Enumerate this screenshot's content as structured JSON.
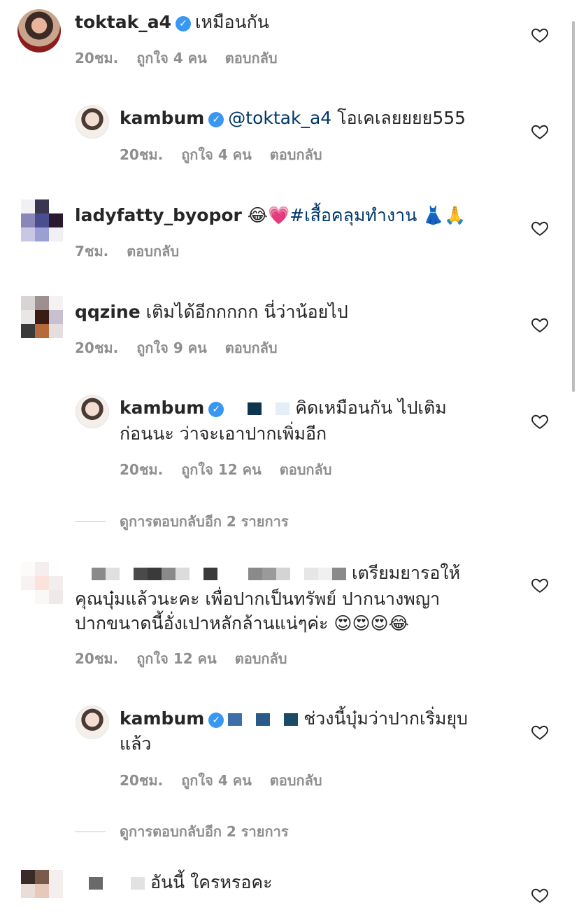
{
  "comments": [
    {
      "user": "toktak_a4",
      "text": "เหมือนกัน",
      "time": "20ชม.",
      "likes": "ถูกใจ 4 คน",
      "reply": "ตอบกลับ"
    },
    {
      "user": "kambum",
      "mention": "@toktak_a4",
      "text": "โอเคเลยยยย555",
      "time": "20ชม.",
      "likes": "ถูกใจ 4 คน",
      "reply": "ตอบกลับ"
    },
    {
      "user": "ladyfatty_byopor",
      "emoji1": "😂💗",
      "tag": "#เสื้อคลุมทำงาน",
      "emoji2": "👗🙏",
      "time": "7ชม.",
      "reply": "ตอบกลับ"
    },
    {
      "user": "qqzine",
      "text": "เติมได้อีกกกกก นี่ว่าน้อยไป",
      "time": "20ชม.",
      "likes": "ถูกใจ 9 คน",
      "reply": "ตอบกลับ"
    },
    {
      "user": "kambum",
      "text_line1": "คิดเหมือนกัน ไปเติม",
      "text_line2": "ก่อนนะ ว่าจะเอาปากเพิ่มอีก",
      "time": "20ชม.",
      "likes": "ถูกใจ 12 คน",
      "reply": "ตอบกลับ"
    },
    {
      "text_line1": "เตรียมยารอให้",
      "text_line2": "คุณบุ๋มแล้วนะคะ  เพื่อปากเป็นทรัพย์  ปากนางพญา",
      "text_line3": "ปากขนาดนี้อั่งเปาหลักล้านแน่ๆค่ะ",
      "emojis": "😍😍😍😂",
      "time": "20ชม.",
      "likes": "ถูกใจ 12 คน",
      "reply": "ตอบกลับ"
    },
    {
      "user": "kambum",
      "text_line1": "ช่วงนี้บุ๋มว่าปากเริ่มยุบ",
      "text_line2": "แล้ว",
      "time": "20ชม.",
      "likes": "ถูกใจ 4 คน",
      "reply": "ตอบกลับ"
    },
    {
      "text": "อันนี้ ใครหรอคะ"
    }
  ],
  "view_more_1": "ดูการตอบกลับอีก 2 รายการ",
  "view_more_2": "ดูการตอบกลับอีก 2 รายการ",
  "verified_glyph": "✓",
  "colors": {
    "mention": "#00376b",
    "verified": "#3897f0",
    "meta": "#8e8e8e"
  }
}
